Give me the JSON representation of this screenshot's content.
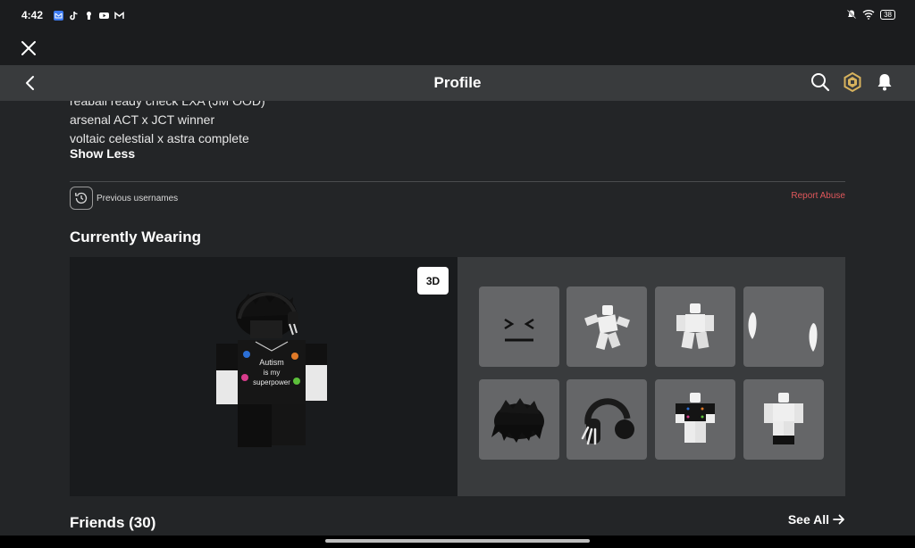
{
  "status": {
    "time": "4:42",
    "battery": "38"
  },
  "nav": {
    "title": "Profile"
  },
  "about": {
    "lines": [
      "reaball ready check LXA (JM OOD)",
      "arsenal ACT x JCT winner",
      "voltaic celestial x astra complete"
    ],
    "show_less": "Show Less"
  },
  "links": {
    "previous_usernames": "Previous usernames",
    "report_abuse": "Report Abuse"
  },
  "wearing": {
    "title": "Currently Wearing",
    "view_toggle": "3D",
    "shirt_text": [
      "Autism",
      "is my",
      "superpower"
    ],
    "items": [
      "face-item",
      "animation-item",
      "animation-item",
      "animation-item",
      "hair-item",
      "headphones-item",
      "shirt-item",
      "pants-item"
    ]
  },
  "friends": {
    "title": "Friends (30)",
    "see_all": "See All"
  },
  "colors": {
    "background": "#232527",
    "navbar": "#393b3d",
    "report": "#e0575b",
    "item_tile": "#656668"
  }
}
